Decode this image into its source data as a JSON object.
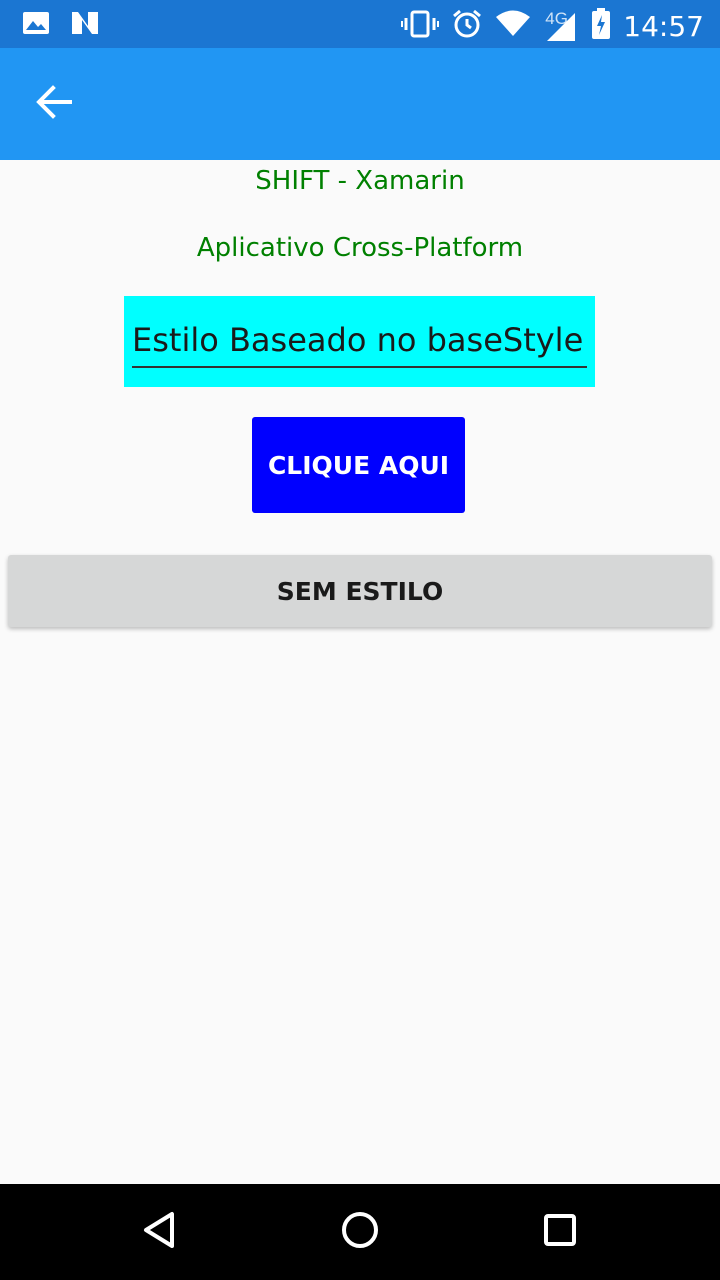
{
  "status_bar": {
    "time": "14:57",
    "network_type": "4G",
    "icons": [
      "image-icon",
      "n-notification-icon",
      "vibrate-icon",
      "alarm-icon",
      "wifi-icon",
      "signal-icon",
      "battery-icon"
    ],
    "background_color": "#1b76d2"
  },
  "app_bar": {
    "background_color": "#2196f3",
    "back_icon": "arrow-back-icon"
  },
  "main": {
    "title": "SHIFT - Xamarin",
    "subtitle": "Aplicativo Cross-Platform",
    "entry_value": "Estilo Baseado no baseStyle",
    "primary_button_label": "CLIQUE AQUI",
    "secondary_button_label": "SEM ESTILO",
    "label_color": "#008000",
    "entry_background": "#00ffff",
    "primary_button_color": "#0000ff"
  },
  "nav_bar": {
    "icons": [
      "back-triangle-icon",
      "home-circle-icon",
      "recents-square-icon"
    ]
  }
}
